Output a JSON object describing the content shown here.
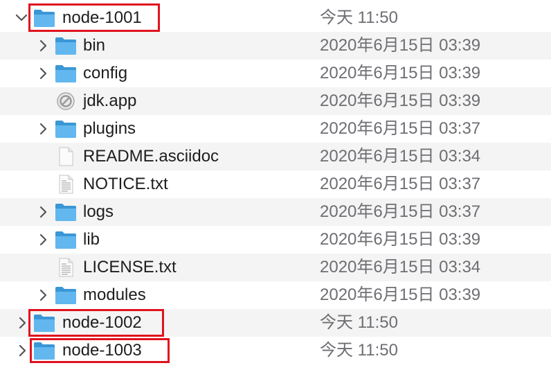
{
  "accent": "#e0121f",
  "folder_color": "#4aa9e6",
  "rows": [
    {
      "name": "node-1001",
      "date": "今天 11:50",
      "icon": "folder-icon",
      "expanded": true
    },
    {
      "name": "bin",
      "date": "2020年6月15日 03:39",
      "icon": "folder-icon"
    },
    {
      "name": "config",
      "date": "2020年6月15日 03:39",
      "icon": "folder-icon"
    },
    {
      "name": "jdk.app",
      "date": "2020年6月15日 03:39",
      "icon": "prohibited-app-icon"
    },
    {
      "name": "plugins",
      "date": "2020年6月15日 03:37",
      "icon": "folder-icon"
    },
    {
      "name": "README.asciidoc",
      "date": "2020年6月15日 03:34",
      "icon": "blank-document-icon"
    },
    {
      "name": "NOTICE.txt",
      "date": "2020年6月15日 03:37",
      "icon": "text-document-icon"
    },
    {
      "name": "logs",
      "date": "2020年6月15日 03:37",
      "icon": "folder-icon"
    },
    {
      "name": "lib",
      "date": "2020年6月15日 03:39",
      "icon": "folder-icon"
    },
    {
      "name": "LICENSE.txt",
      "date": "2020年6月15日 03:34",
      "icon": "text-document-icon"
    },
    {
      "name": "modules",
      "date": "2020年6月15日 03:39",
      "icon": "folder-icon"
    },
    {
      "name": "node-1002",
      "date": "今天 11:50",
      "icon": "folder-icon",
      "expanded": false
    },
    {
      "name": "node-1003",
      "date": "今天 11:50",
      "icon": "folder-icon",
      "expanded": false
    }
  ]
}
